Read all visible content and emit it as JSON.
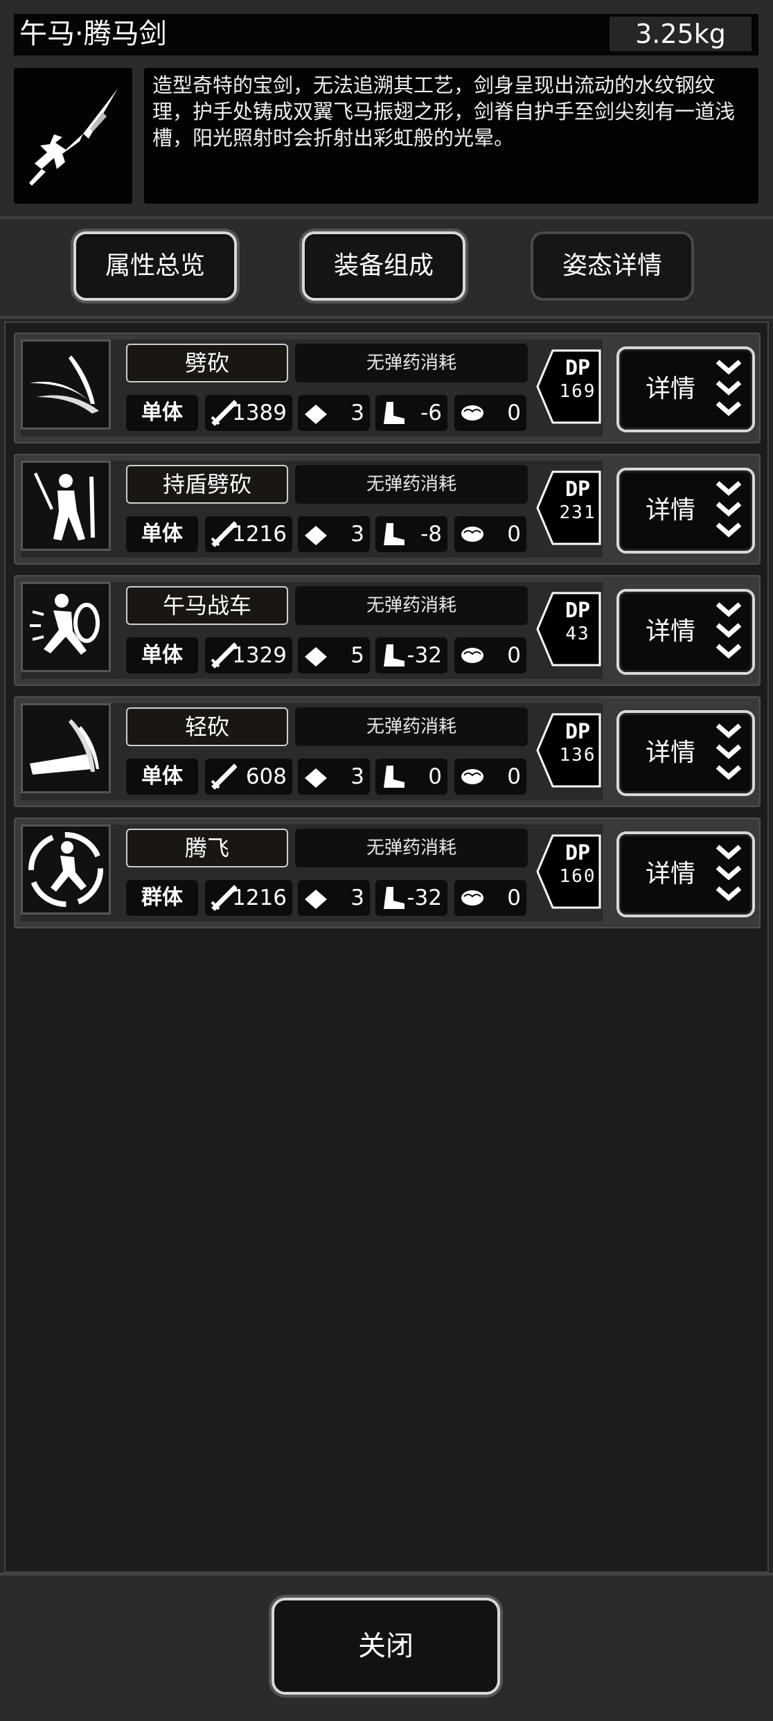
{
  "header": {
    "weapon_name": "午马·腾马剑",
    "weight": "3.25kg",
    "weapon_icon": "sword-icon",
    "description": "造型奇特的宝剑，无法追溯其工艺，剑身呈现出流动的水纹钢纹理，护手处铸成双翼飞马振翅之形，剑脊自护手至剑尖刻有一道浅槽，阳光照射时会折射出彩虹般的光晕。"
  },
  "tabs": [
    {
      "label": "属性总览",
      "active": true
    },
    {
      "label": "装备组成",
      "active": true
    },
    {
      "label": "姿态详情",
      "active": false
    }
  ],
  "skills": [
    {
      "name": "劈砍",
      "ammo": "无弹药消耗",
      "target": "单体",
      "attack": "1389",
      "accuracy": "3",
      "speed": "-6",
      "mind": "0",
      "dp_label": "DP",
      "dp": "169",
      "detail": "详情",
      "icon": "slash-icon"
    },
    {
      "name": "持盾劈砍",
      "ammo": "无弹药消耗",
      "target": "单体",
      "attack": "1216",
      "accuracy": "3",
      "speed": "-8",
      "mind": "0",
      "dp_label": "DP",
      "dp": "231",
      "detail": "详情",
      "icon": "shield-slash-icon"
    },
    {
      "name": "午马战车",
      "ammo": "无弹药消耗",
      "target": "单体",
      "attack": "1329",
      "accuracy": "5",
      "speed": "-32",
      "mind": "0",
      "dp_label": "DP",
      "dp": "43",
      "detail": "详情",
      "icon": "charge-icon"
    },
    {
      "name": "轻砍",
      "ammo": "无弹药消耗",
      "target": "单体",
      "attack": "608",
      "accuracy": "3",
      "speed": "0",
      "mind": "0",
      "dp_label": "DP",
      "dp": "136",
      "detail": "详情",
      "icon": "light-slash-icon"
    },
    {
      "name": "腾飞",
      "ammo": "无弹药消耗",
      "target": "群体",
      "attack": "1216",
      "accuracy": "3",
      "speed": "-32",
      "mind": "0",
      "dp_label": "DP",
      "dp": "160",
      "detail": "详情",
      "icon": "leap-icon"
    }
  ],
  "footer": {
    "close_label": "关闭"
  },
  "colors": {
    "background": "#262626",
    "panel": "#2b2b2b",
    "border": "#d8d8d8"
  }
}
